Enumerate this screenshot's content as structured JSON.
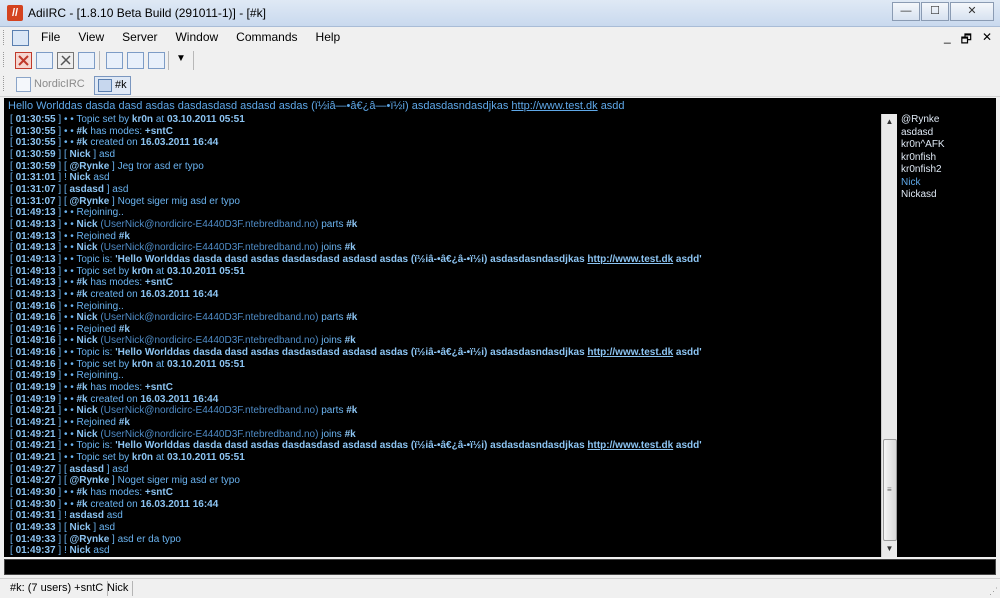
{
  "window": {
    "app_icon_letter": "//",
    "title": "AdiIRC - [1.8.10 Beta Build (291011-1)] - [#k]",
    "buttons": {
      "minimize": "—",
      "maximize": "☐",
      "close": "✕"
    }
  },
  "menu": {
    "items": [
      "File",
      "View",
      "Server",
      "Window",
      "Commands",
      "Help"
    ],
    "mdi": {
      "minimize": "_",
      "restore": "🗗",
      "close": "✕"
    }
  },
  "switchbar": {
    "server": "NordicIRC",
    "channel": "#k"
  },
  "topic": {
    "text": "Hello Worlddas dasda dasd asdas dasdasdasd asdasd asdas (ï½iâ—•â€¿â—•ï½i) asdasdasndasdjkas",
    "link": "http://www.test.dk",
    "suffix": "asdd"
  },
  "chat_lines": [
    {
      "ts": "01:30:55",
      "pre": "• • ",
      "parts": [
        {
          "t": "Topic set by "
        },
        {
          "b": "kr0n"
        },
        {
          "t": " at "
        },
        {
          "b": "03.10.2011 05:51"
        }
      ]
    },
    {
      "ts": "01:30:55",
      "pre": "• • ",
      "parts": [
        {
          "b": "#k"
        },
        {
          "t": " has modes: "
        },
        {
          "b": "+sntC"
        }
      ]
    },
    {
      "ts": "01:30:55",
      "pre": "• • ",
      "parts": [
        {
          "b": "#k"
        },
        {
          "t": " created on "
        },
        {
          "b": "16.03.2011 16:44"
        }
      ]
    },
    {
      "ts": "01:30:59",
      "pre": "[ ",
      "parts": [
        {
          "b": "Nick"
        },
        {
          "t": " ] asd"
        }
      ]
    },
    {
      "ts": "01:30:59",
      "pre": "[ ",
      "parts": [
        {
          "b": "@Rynke"
        },
        {
          "t": " ] Jeg tror asd er typo"
        }
      ]
    },
    {
      "ts": "01:31:01",
      "pre": "! ",
      "parts": [
        {
          "b": "Nick"
        },
        {
          "t": " asd"
        }
      ]
    },
    {
      "ts": "01:31:07",
      "pre": "[ ",
      "parts": [
        {
          "b": "asdasd"
        },
        {
          "t": " ] asd"
        }
      ]
    },
    {
      "ts": "01:31:07",
      "pre": "[ ",
      "parts": [
        {
          "b": "@Rynke"
        },
        {
          "t": " ] Noget siger mig asd er typo"
        }
      ]
    },
    {
      "ts": "01:49:13",
      "pre": "• • ",
      "parts": [
        {
          "t": "Rejoining.."
        }
      ]
    },
    {
      "ts": "01:49:13",
      "pre": "• • ",
      "parts": [
        {
          "b": "Nick"
        },
        {
          "d": " (UserNick@nordicirc-E4440D3F.ntebredband.no)"
        },
        {
          "t": " parts "
        },
        {
          "b": "#k"
        }
      ]
    },
    {
      "ts": "01:49:13",
      "pre": "• • ",
      "parts": [
        {
          "t": "Rejoined "
        },
        {
          "b": "#k"
        }
      ]
    },
    {
      "ts": "01:49:13",
      "pre": "• • ",
      "parts": [
        {
          "b": "Nick"
        },
        {
          "d": " (UserNick@nordicirc-E4440D3F.ntebredband.no)"
        },
        {
          "t": " joins "
        },
        {
          "b": "#k"
        }
      ]
    },
    {
      "ts": "01:49:13",
      "pre": "• • ",
      "parts": [
        {
          "t": "Topic is: "
        },
        {
          "b": "'Hello Worlddas dasda dasd asdas dasdasdasd asdasd asdas (ï½iâ-•â€¿â-•ï½i) asdasdasndasdjkas "
        },
        {
          "a": "http://www.test.dk"
        },
        {
          "b": " asdd'"
        }
      ]
    },
    {
      "ts": "01:49:13",
      "pre": "• • ",
      "parts": [
        {
          "t": "Topic set by "
        },
        {
          "b": "kr0n"
        },
        {
          "t": " at "
        },
        {
          "b": "03.10.2011 05:51"
        }
      ]
    },
    {
      "ts": "01:49:13",
      "pre": "• • ",
      "parts": [
        {
          "b": "#k"
        },
        {
          "t": " has modes: "
        },
        {
          "b": "+sntC"
        }
      ]
    },
    {
      "ts": "01:49:13",
      "pre": "• • ",
      "parts": [
        {
          "b": "#k"
        },
        {
          "t": " created on "
        },
        {
          "b": "16.03.2011 16:44"
        }
      ]
    },
    {
      "ts": "01:49:16",
      "pre": "• • ",
      "parts": [
        {
          "t": "Rejoining.."
        }
      ]
    },
    {
      "ts": "01:49:16",
      "pre": "• • ",
      "parts": [
        {
          "b": "Nick"
        },
        {
          "d": " (UserNick@nordicirc-E4440D3F.ntebredband.no)"
        },
        {
          "t": " parts "
        },
        {
          "b": "#k"
        }
      ]
    },
    {
      "ts": "01:49:16",
      "pre": "• • ",
      "parts": [
        {
          "t": "Rejoined "
        },
        {
          "b": "#k"
        }
      ]
    },
    {
      "ts": "01:49:16",
      "pre": "• • ",
      "parts": [
        {
          "b": "Nick"
        },
        {
          "d": " (UserNick@nordicirc-E4440D3F.ntebredband.no)"
        },
        {
          "t": " joins "
        },
        {
          "b": "#k"
        }
      ]
    },
    {
      "ts": "01:49:16",
      "pre": "• • ",
      "parts": [
        {
          "t": "Topic is: "
        },
        {
          "b": "'Hello Worlddas dasda dasd asdas dasdasdasd asdasd asdas (ï½iâ-•â€¿â-•ï½i) asdasdasndasdjkas "
        },
        {
          "a": "http://www.test.dk"
        },
        {
          "b": " asdd'"
        }
      ]
    },
    {
      "ts": "01:49:16",
      "pre": "• • ",
      "parts": [
        {
          "t": "Topic set by "
        },
        {
          "b": "kr0n"
        },
        {
          "t": " at "
        },
        {
          "b": "03.10.2011 05:51"
        }
      ]
    },
    {
      "ts": "01:49:19",
      "pre": "• • ",
      "parts": [
        {
          "t": "Rejoining.."
        }
      ]
    },
    {
      "ts": "01:49:19",
      "pre": "• • ",
      "parts": [
        {
          "b": "#k"
        },
        {
          "t": " has modes: "
        },
        {
          "b": "+sntC"
        }
      ]
    },
    {
      "ts": "01:49:19",
      "pre": "• • ",
      "parts": [
        {
          "b": "#k"
        },
        {
          "t": " created on "
        },
        {
          "b": "16.03.2011 16:44"
        }
      ]
    },
    {
      "ts": "01:49:21",
      "pre": "• • ",
      "parts": [
        {
          "b": "Nick"
        },
        {
          "d": " (UserNick@nordicirc-E4440D3F.ntebredband.no)"
        },
        {
          "t": " parts "
        },
        {
          "b": "#k"
        }
      ]
    },
    {
      "ts": "01:49:21",
      "pre": "• • ",
      "parts": [
        {
          "t": "Rejoined "
        },
        {
          "b": "#k"
        }
      ]
    },
    {
      "ts": "01:49:21",
      "pre": "• • ",
      "parts": [
        {
          "b": "Nick"
        },
        {
          "d": " (UserNick@nordicirc-E4440D3F.ntebredband.no)"
        },
        {
          "t": " joins "
        },
        {
          "b": "#k"
        }
      ]
    },
    {
      "ts": "01:49:21",
      "pre": "• • ",
      "parts": [
        {
          "t": "Topic is: "
        },
        {
          "b": "'Hello Worlddas dasda dasd asdas dasdasdasd asdasd asdas (ï½iâ-•â€¿â-•ï½i) asdasdasndasdjkas "
        },
        {
          "a": "http://www.test.dk"
        },
        {
          "b": " asdd'"
        }
      ]
    },
    {
      "ts": "01:49:21",
      "pre": "• • ",
      "parts": [
        {
          "t": "Topic set by "
        },
        {
          "b": "kr0n"
        },
        {
          "t": " at "
        },
        {
          "b": "03.10.2011 05:51"
        }
      ]
    },
    {
      "ts": "01:49:27",
      "pre": "[ ",
      "parts": [
        {
          "b": "asdasd"
        },
        {
          "t": " ] asd"
        }
      ]
    },
    {
      "ts": "01:49:27",
      "pre": "[ ",
      "parts": [
        {
          "b": "@Rynke"
        },
        {
          "t": " ] Noget siger mig asd er typo"
        }
      ]
    },
    {
      "ts": "01:49:30",
      "pre": "• • ",
      "parts": [
        {
          "b": "#k"
        },
        {
          "t": " has modes: "
        },
        {
          "b": "+sntC"
        }
      ]
    },
    {
      "ts": "01:49:30",
      "pre": "• • ",
      "parts": [
        {
          "b": "#k"
        },
        {
          "t": " created on "
        },
        {
          "b": "16.03.2011 16:44"
        }
      ]
    },
    {
      "ts": "01:49:31",
      "pre": "! ",
      "parts": [
        {
          "b": "asdasd"
        },
        {
          "t": " asd"
        }
      ]
    },
    {
      "ts": "01:49:33",
      "pre": "[ ",
      "parts": [
        {
          "b": "Nick"
        },
        {
          "t": " ] asd"
        }
      ]
    },
    {
      "ts": "01:49:33",
      "pre": "[ ",
      "parts": [
        {
          "b": "@Rynke"
        },
        {
          "t": " ] asd er da typo"
        }
      ]
    },
    {
      "ts": "01:49:37",
      "pre": "! ",
      "parts": [
        {
          "b": "Nick"
        },
        {
          "t": " asd"
        }
      ]
    }
  ],
  "nicklist": [
    {
      "name": "@Rynke",
      "color": "#dfe9f5"
    },
    {
      "name": "asdasd",
      "color": "#dfe9f5"
    },
    {
      "name": "kr0n^AFK",
      "color": "#dfe9f5"
    },
    {
      "name": "kr0nfish",
      "color": "#dfe9f5"
    },
    {
      "name": "kr0nfish2",
      "color": "#dfe9f5"
    },
    {
      "name": "Nick",
      "color": "#5fa8e8"
    },
    {
      "name": "Nickasd",
      "color": "#dfe9f5"
    }
  ],
  "editbox": {
    "value": ""
  },
  "statusbar": {
    "channel_info": "#k: (7 users) +sntC",
    "nick": "Nick"
  },
  "colors": {
    "background": "#000000",
    "text": "#6ab3f0",
    "highlight": "#8cc4f2",
    "accent_red": "#d4431f"
  },
  "icons": [
    "app-icon",
    "disconnect-icon",
    "channel-list-icon",
    "options-icon",
    "scripts-icon",
    "tile-cascade-icon",
    "tile-horizontal-icon",
    "tile-vertical-icon",
    "dropdown-arrow-icon",
    "server-icon",
    "channel-icon",
    "scroll-up-icon",
    "scroll-down-icon"
  ]
}
